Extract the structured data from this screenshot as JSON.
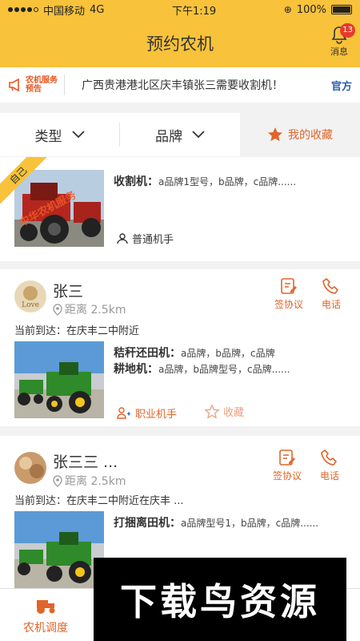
{
  "status": {
    "carrier": "中国移动",
    "network": "4G",
    "time": "下午1:19",
    "battery": "100%"
  },
  "navbar": {
    "title": "预约农机",
    "msg_label": "消息",
    "msg_count": "13"
  },
  "notice": {
    "tag_line1": "农机服务",
    "tag_line2": "预告",
    "text": "广西贵港港北区庆丰镇张三需要收割机！",
    "official": "官方"
  },
  "filter": {
    "type_label": "类型",
    "brand_label": "品牌",
    "favorites_label": "我的收藏"
  },
  "card1": {
    "ribbon": "自己",
    "watermark": "中华农机服务",
    "line1_name": "收割机：",
    "line1_brands": "a品牌1型号，b品牌，c品牌......",
    "role": "普通机手"
  },
  "card2": {
    "name": "张三",
    "distance": "距离 2.5km",
    "agreement": "签协议",
    "phone": "电话",
    "arrive": "当前到达：在庆丰二中附近",
    "line1_name": "秸秆还田机：",
    "line1_brands": "a品牌，b品牌，c品牌",
    "line2_name": "耕地机：",
    "line2_brands": "a品牌，b品牌型号，c品牌......",
    "role": "职业机手",
    "favorite": "收藏"
  },
  "card3": {
    "name": "张三三 ...",
    "distance": "距离 2.5km",
    "agreement": "签协议",
    "phone": "电话",
    "arrive": "当前到达：在庆丰二中附近在庆丰 ...",
    "line1_name": "打捆离田机：",
    "line1_brands": "a品牌型号1，b品牌，c品牌......"
  },
  "tabbar": {
    "tab1_label": "农机调度"
  },
  "watermark": {
    "text": "下载鸟资源"
  }
}
